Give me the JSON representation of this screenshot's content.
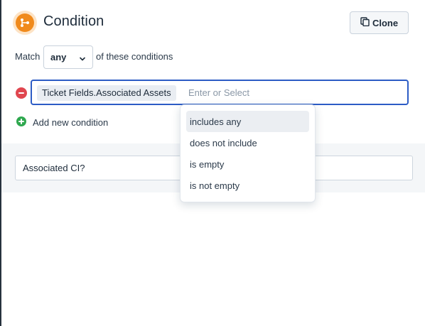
{
  "header": {
    "title": "Condition",
    "icon": "workflow-branch-icon",
    "accent": "#f08a1c",
    "clone_label": "Clone"
  },
  "match": {
    "prefix": "Match",
    "selected": "any",
    "suffix": "of these conditions"
  },
  "condition": {
    "field_chip": "Ticket Fields.Associated Assets",
    "operator_placeholder": "Enter or Select",
    "focus_color": "#2c5cc5"
  },
  "add_condition_label": "Add new condition",
  "lower": {
    "field_value": "Associated CI?"
  },
  "operator_dropdown": {
    "options": [
      "includes any",
      "does not include",
      "is empty",
      "is not empty"
    ],
    "highlighted": "includes any"
  }
}
